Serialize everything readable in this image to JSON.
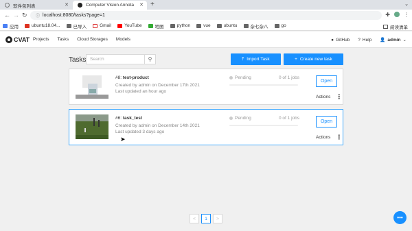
{
  "browser": {
    "tabs": [
      {
        "title": "软件包列表",
        "active": false
      },
      {
        "title": "Computer Vision Annota",
        "active": true
      }
    ],
    "url": "localhost:8080/tasks?page=1",
    "bookmarks": [
      {
        "label": "应用",
        "icon": "apps-icon"
      },
      {
        "label": "ubuntu18.04...",
        "icon": "ubuntu-icon"
      },
      {
        "label": "已导入",
        "icon": "folder-icon"
      },
      {
        "label": "Gmail",
        "icon": "gmail-icon"
      },
      {
        "label": "YouTube",
        "icon": "youtube-icon"
      },
      {
        "label": "地图",
        "icon": "maps-icon"
      },
      {
        "label": "python",
        "icon": "folder-icon"
      },
      {
        "label": "vue",
        "icon": "folder-icon"
      },
      {
        "label": "ubuntu",
        "icon": "folder-icon"
      },
      {
        "label": "杂七杂八",
        "icon": "folder-icon"
      },
      {
        "label": "go",
        "icon": "folder-icon"
      }
    ],
    "reading_list": "阅读清单"
  },
  "header": {
    "logo": "CVAT",
    "nav": [
      "Projects",
      "Tasks",
      "Cloud Storages",
      "Models"
    ],
    "github": "GitHub",
    "help": "Help",
    "user": "admin"
  },
  "tasks_page": {
    "title": "Tasks",
    "search_placeholder": "Search",
    "import_label": "Import Task",
    "create_label": "Create new task",
    "tasks": [
      {
        "id_prefix": "#8: ",
        "name": "test-product",
        "created": "Created by admin on December 17th 2021",
        "updated": "Last updated an hour ago",
        "status": "Pending",
        "jobs": "0 of 1 jobs",
        "progress": 0,
        "open_label": "Open",
        "actions_label": "Actions",
        "selected": false
      },
      {
        "id_prefix": "#6: ",
        "name": "task_test",
        "created": "Created by admin on December 14th 2021",
        "updated": "Last updated 3 days ago",
        "status": "Pending",
        "jobs": "0 of 1 jobs",
        "progress": 0,
        "open_label": "Open",
        "actions_label": "Actions",
        "selected": true
      }
    ],
    "pagination": {
      "prev": "<",
      "current": "1",
      "next": ">"
    }
  },
  "colors": {
    "primary": "#1890ff",
    "border": "#d9d9d9",
    "background": "#f0f0f0"
  }
}
